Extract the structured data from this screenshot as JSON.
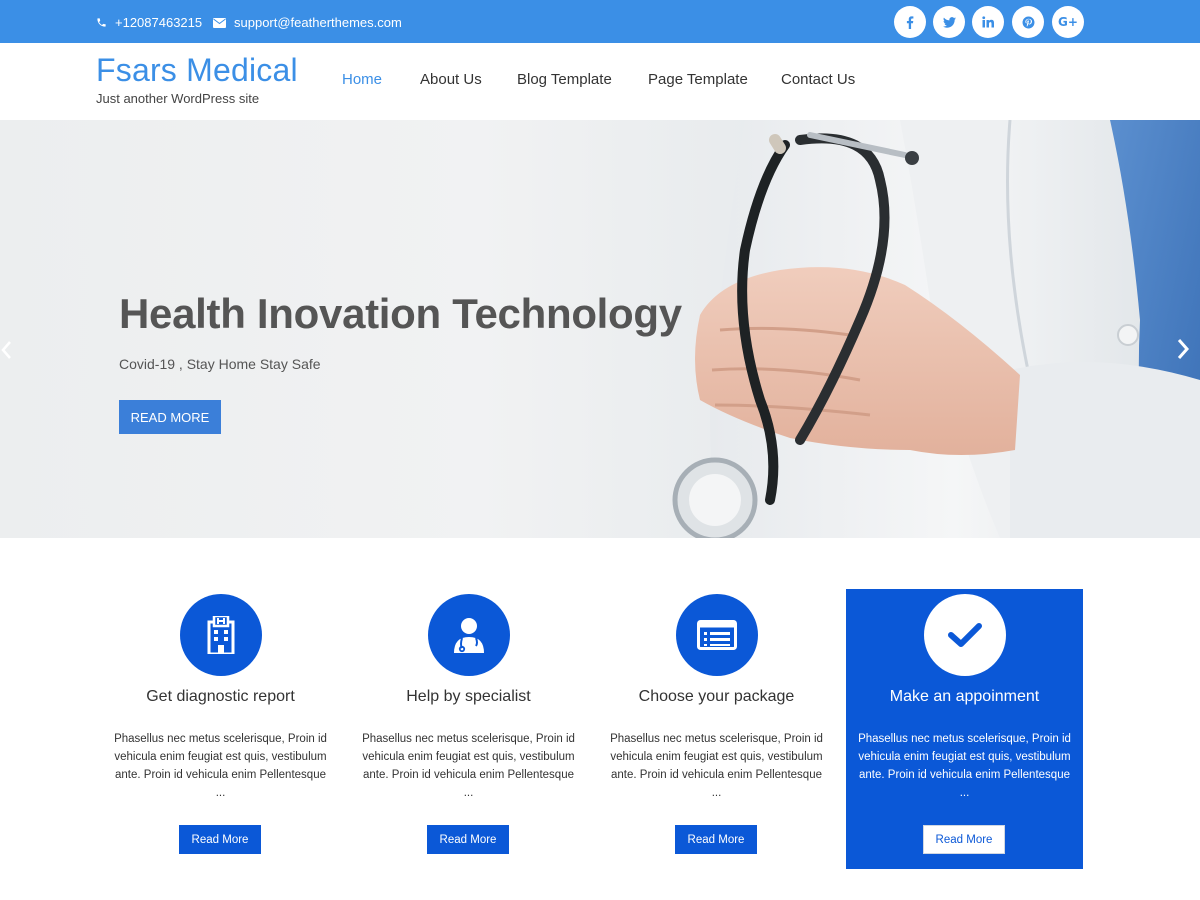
{
  "topbar": {
    "phone": "+12087463215",
    "email": "support@featherthemes.com",
    "social": [
      {
        "icon": "facebook-icon"
      },
      {
        "icon": "twitter-icon"
      },
      {
        "icon": "linkedin-icon"
      },
      {
        "icon": "pinterest-icon"
      },
      {
        "icon": "google-plus-icon",
        "glyph": "G+"
      }
    ]
  },
  "header": {
    "site_title": "Fsars Medical",
    "tagline": "Just another WordPress site",
    "nav": [
      "Home",
      "About Us",
      "Blog Template",
      "Page Template",
      "Contact Us"
    ],
    "active_nav": "Home"
  },
  "hero": {
    "title": "Health Inovation Technology",
    "subtitle": "Covid-19 , Stay Home Stay Safe",
    "button": "READ MORE"
  },
  "features": [
    {
      "icon": "hospital-icon",
      "title": "Get diagnostic report",
      "description": "Phasellus nec metus scelerisque, Proin id vehicula enim feugiat est quis, vestibulum ante. Proin id vehicula enim Pellentesque ...",
      "button": "Read More"
    },
    {
      "icon": "doctor-icon",
      "title": "Help by specialist",
      "description": "Phasellus nec metus scelerisque, Proin id vehicula enim feugiat est quis, vestibulum ante. Proin id vehicula enim Pellentesque ...",
      "button": "Read More"
    },
    {
      "icon": "list-card-icon",
      "title": "Choose your package",
      "description": "Phasellus nec metus scelerisque, Proin id vehicula enim feugiat est quis, vestibulum ante. Proin id vehicula enim Pellentesque ...",
      "button": "Read More"
    },
    {
      "icon": "checkmark-icon",
      "title": "Make an appoinment",
      "description": "Phasellus nec metus scelerisque, Proin id vehicula enim feugiat est quis, vestibulum ante. Proin id vehicula enim Pellentesque ...",
      "button": "Read More"
    }
  ],
  "colors": {
    "topbar": "#3b8fe6",
    "primary": "#0b58d7",
    "link_active": "#3b8fe6"
  }
}
